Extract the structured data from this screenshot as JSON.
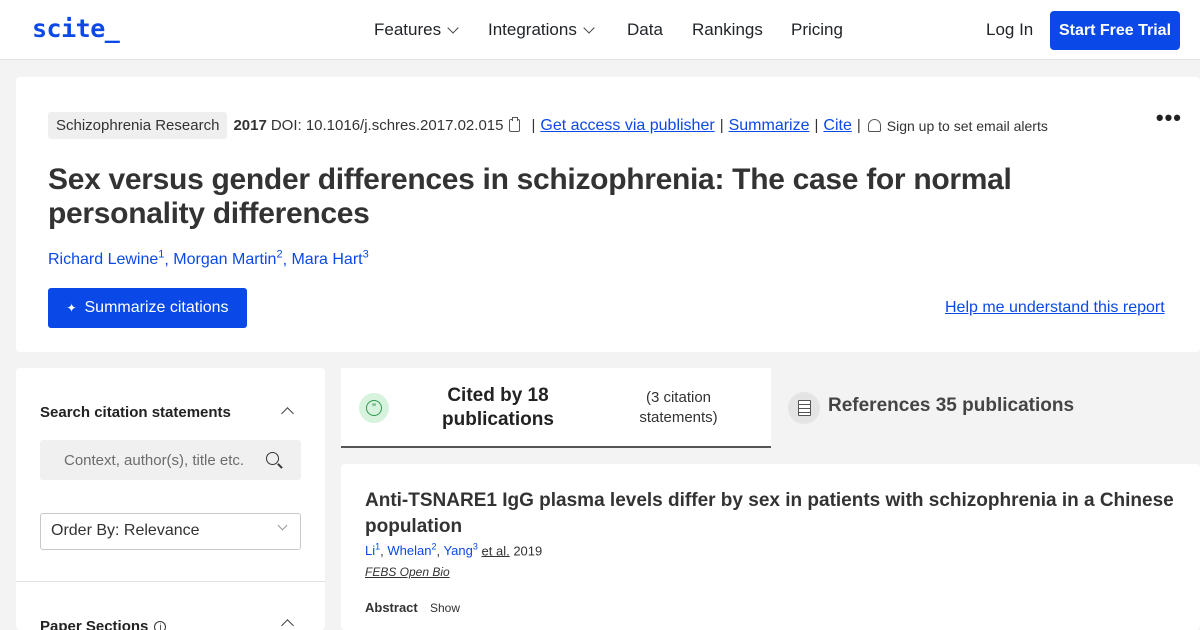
{
  "nav": {
    "logo": "scite_",
    "items": [
      {
        "label": "Features"
      },
      {
        "label": "Integrations"
      },
      {
        "label": "Data"
      },
      {
        "label": "Rankings"
      },
      {
        "label": "Pricing"
      }
    ],
    "login": "Log In",
    "trial": "Start Free Trial"
  },
  "paper": {
    "journal": "Schizophrenia Research",
    "year": "2017",
    "doi": "DOI: 10.1016/j.schres.2017.02.015",
    "links": {
      "access": "Get access via publisher",
      "summarize": "Summarize",
      "cite": "Cite",
      "alerts": "Sign up to set email alerts"
    },
    "more": "•••",
    "title": "Sex versus gender differences in schizophrenia: The case for normal personality differences",
    "authors": [
      {
        "name": "Richard Lewine",
        "sup": "1"
      },
      {
        "name": "Morgan Martin",
        "sup": "2"
      },
      {
        "name": "Mara Hart",
        "sup": "3"
      }
    ],
    "summarize_button": "Summarize citations",
    "help_link": "Help me understand this report"
  },
  "sidebar": {
    "search_heading": "Search citation statements",
    "search_placeholder": "Context, author(s), title etc.",
    "order_by": "Order By: Relevance",
    "sections_heading": "Paper Sections"
  },
  "tabs": {
    "cited_by": "Cited by 18 publications",
    "statements": "(3 citation statements)",
    "references": "References 35 publications"
  },
  "citation": {
    "title": "Anti-TSNARE1 IgG plasma levels differ by sex in patients with schizophrenia in a Chinese population",
    "authors": [
      {
        "name": "Li",
        "sup": "1"
      },
      {
        "name": "Whelan",
        "sup": "2"
      },
      {
        "name": "Yang",
        "sup": "3"
      }
    ],
    "et_al": "et al.",
    "year": "2019",
    "journal": "FEBS Open Bio",
    "abstract_label": "Abstract",
    "show_label": "Show"
  }
}
